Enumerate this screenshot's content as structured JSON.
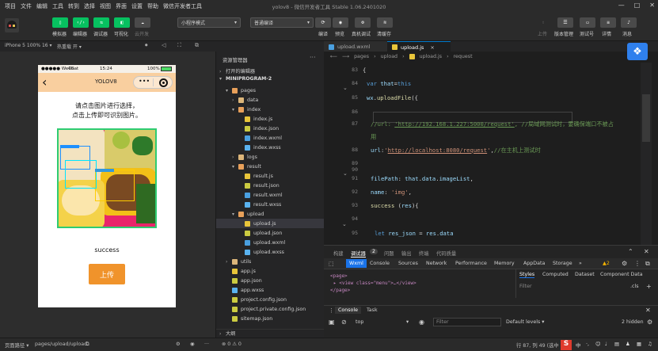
{
  "menubar": {
    "items": [
      "项目",
      "文件",
      "编辑",
      "工具",
      "转到",
      "选择",
      "视图",
      "界面",
      "设置",
      "帮助",
      "微信开发者工具"
    ],
    "title": "yolov8 - 微信开发者工具 Stable 1.06.2401020",
    "controls": [
      "—",
      "□",
      "✕"
    ]
  },
  "toolbar": {
    "left_buttons": [
      {
        "label": "模拟器",
        "icon": "phone-icon"
      },
      {
        "label": "编辑器",
        "icon": "code-icon"
      },
      {
        "label": "调试器",
        "icon": "debug-icon"
      },
      {
        "label": "可视化",
        "icon": "visual-icon"
      },
      {
        "label": "云开发",
        "icon": "cloud-icon"
      }
    ],
    "mode_select": "小程序模式",
    "compile_select": "普通编译",
    "right_buttons": [
      {
        "label": "编译",
        "icon": "refresh-icon"
      },
      {
        "label": "预览",
        "icon": "eye-icon"
      },
      {
        "label": "真机调试",
        "icon": "phone-debug-icon"
      },
      {
        "label": "清缓存",
        "icon": "layers-icon"
      }
    ],
    "far_right_buttons": [
      {
        "label": "上传",
        "icon": "upload-icon"
      },
      {
        "label": "版本管理",
        "icon": "version-icon"
      },
      {
        "label": "测试号",
        "icon": "test-icon"
      },
      {
        "label": "详情",
        "icon": "details-icon"
      },
      {
        "label": "消息",
        "icon": "bell-icon"
      }
    ]
  },
  "subbar": {
    "device": "iPhone 5 100% 16 ▾",
    "hotreload": "热重载 开 ▾"
  },
  "phone": {
    "status_left": "●●●●● WeChat",
    "status_signal": "4G",
    "status_time": "15:24",
    "status_battery": "100%",
    "nav_title": "YOLOV8",
    "nav_back": "‹",
    "instruction_line1": "请点击图片进行选择，",
    "instruction_line2": "点击上传即可识别图片。",
    "result_text": "success",
    "upload_button": "上传"
  },
  "explorer": {
    "header": "资源管理器",
    "section_open": "打开的编辑器",
    "section_project": "MINIPROGRAM-2",
    "outline": "大纲",
    "timeline": "⊗ 0 ⚠ 0",
    "tree": [
      {
        "label": "pages",
        "indent": 1,
        "kind": "folder-o",
        "caret": "▾"
      },
      {
        "label": "data",
        "indent": 2,
        "kind": "folder",
        "caret": "›"
      },
      {
        "label": "index",
        "indent": 2,
        "kind": "folder-o",
        "caret": "▾"
      },
      {
        "label": "index.js",
        "indent": 3,
        "kind": "js",
        "caret": ""
      },
      {
        "label": "index.json",
        "indent": 3,
        "kind": "json",
        "caret": ""
      },
      {
        "label": "index.wxml",
        "indent": 3,
        "kind": "wxml",
        "caret": ""
      },
      {
        "label": "index.wxss",
        "indent": 3,
        "kind": "wxss",
        "caret": ""
      },
      {
        "label": "logs",
        "indent": 2,
        "kind": "folder",
        "caret": "›"
      },
      {
        "label": "result",
        "indent": 2,
        "kind": "folder-o",
        "caret": "▾"
      },
      {
        "label": "result.js",
        "indent": 3,
        "kind": "js",
        "caret": ""
      },
      {
        "label": "result.json",
        "indent": 3,
        "kind": "json",
        "caret": ""
      },
      {
        "label": "result.wxml",
        "indent": 3,
        "kind": "wxml",
        "caret": ""
      },
      {
        "label": "result.wxss",
        "indent": 3,
        "kind": "wxss",
        "caret": ""
      },
      {
        "label": "upload",
        "indent": 2,
        "kind": "folder-o",
        "caret": "▾"
      },
      {
        "label": "upload.js",
        "indent": 3,
        "kind": "js",
        "caret": "",
        "selected": true
      },
      {
        "label": "upload.json",
        "indent": 3,
        "kind": "json",
        "caret": ""
      },
      {
        "label": "upload.wxml",
        "indent": 3,
        "kind": "wxml",
        "caret": ""
      },
      {
        "label": "upload.wxss",
        "indent": 3,
        "kind": "wxss",
        "caret": ""
      },
      {
        "label": "utils",
        "indent": 1,
        "kind": "folder",
        "caret": "›"
      },
      {
        "label": "app.js",
        "indent": 1,
        "kind": "js",
        "caret": ""
      },
      {
        "label": "app.json",
        "indent": 1,
        "kind": "json",
        "caret": ""
      },
      {
        "label": "app.wxss",
        "indent": 1,
        "kind": "wxss",
        "caret": ""
      },
      {
        "label": "project.config.json",
        "indent": 1,
        "kind": "json",
        "caret": ""
      },
      {
        "label": "project.private.config.json",
        "indent": 1,
        "kind": "json",
        "caret": ""
      },
      {
        "label": "sitemap.json",
        "indent": 1,
        "kind": "json",
        "caret": ""
      }
    ]
  },
  "editor": {
    "tabs": [
      {
        "label": "upload.wxml",
        "active": false
      },
      {
        "label": "upload.js",
        "active": true
      }
    ],
    "breadcrumb": [
      "pages",
      "upload",
      "upload.js",
      "request"
    ],
    "lines": [
      {
        "num": "83",
        "html": [
          [
            "{",
            "plain"
          ]
        ]
      },
      {
        "num": "84",
        "html": [
          [
            "var ",
            "kw"
          ],
          [
            "that",
            "var"
          ],
          [
            "=",
            "plain"
          ],
          [
            "this",
            "kw"
          ]
        ]
      },
      {
        "num": "85",
        "html": [
          [
            "wx",
            "var"
          ],
          [
            ".",
            "plain"
          ],
          [
            "uploadFile",
            "fn"
          ],
          [
            "({",
            "plain"
          ]
        ]
      },
      {
        "num": "86",
        "html": []
      },
      {
        "num": "87",
        "html": [
          [
            "//url: ",
            "cmt"
          ],
          [
            "'http://192.168.1.227:5000/request'",
            "cmt-link"
          ],
          [
            ", //局域网测试时，要确保端口不被占",
            "cmt"
          ]
        ]
      },
      {
        "num": "",
        "html": [
          [
            "用",
            "cmt"
          ]
        ]
      },
      {
        "num": "88",
        "html": [
          [
            "url",
            "var"
          ],
          [
            ":",
            "plain"
          ],
          [
            "'",
            "str"
          ],
          [
            "http://localhost:8080/request",
            "link"
          ],
          [
            "'",
            "str"
          ],
          [
            ",",
            "plain"
          ],
          [
            "//在主机上测试时",
            "cmt"
          ]
        ]
      },
      {
        "num": "89",
        "html": []
      },
      {
        "num": "90",
        "html": []
      },
      {
        "num": "91",
        "html": [
          [
            "filePath",
            "var"
          ],
          [
            ": ",
            "plain"
          ],
          [
            "that",
            "var"
          ],
          [
            ".",
            "plain"
          ],
          [
            "data",
            "var"
          ],
          [
            ".",
            "plain"
          ],
          [
            "imageList",
            "var"
          ],
          [
            ",",
            "plain"
          ]
        ]
      },
      {
        "num": "92",
        "html": [
          [
            "name",
            "var"
          ],
          [
            ": ",
            "plain"
          ],
          [
            "'img'",
            "str"
          ],
          [
            ",",
            "plain"
          ]
        ]
      },
      {
        "num": "93",
        "html": [
          [
            "success",
            "fn"
          ],
          [
            " (",
            "plain"
          ],
          [
            "res",
            "var"
          ],
          [
            "){",
            "plain"
          ]
        ]
      },
      {
        "num": "94",
        "html": []
      },
      {
        "num": "95",
        "html": [
          [
            "let ",
            "kw"
          ],
          [
            "res_json",
            "var"
          ],
          [
            " = ",
            "plain"
          ],
          [
            "res",
            "var"
          ],
          [
            ".",
            "plain"
          ],
          [
            "data",
            "var"
          ]
        ]
      },
      {
        "num": "96",
        "html": []
      }
    ]
  },
  "devtools": {
    "top_tabs": [
      "构建",
      "调试器",
      "2",
      "问题",
      "输出",
      "终端",
      "代码质量"
    ],
    "panel_tabs": [
      "Wxml",
      "Console",
      "Sources",
      "Network",
      "Performance",
      "Memory",
      "AppData",
      "Storage",
      "»"
    ],
    "warn_count": "▲2",
    "wxml_lines": [
      "<page>",
      "▸ <view class=\"menu\">…</view>",
      "</page>"
    ],
    "style_tabs": [
      "Styles",
      "Computed",
      "Dataset",
      "Component Data"
    ],
    "filter_placeholder": "Filter",
    "cls": ".cls",
    "drawer_tabs": [
      "Console",
      "Task"
    ],
    "context": "top",
    "console_filter": "Filter",
    "levels": "Default levels ▾",
    "hidden": "2 hidden"
  },
  "statusbar": {
    "path_label": "页面路径 ▾",
    "path": "pages/upload/upload",
    "position": "行 87, 列 49 (选中 34)",
    "encoding_hint": "空格: 2",
    "ime": "中"
  }
}
